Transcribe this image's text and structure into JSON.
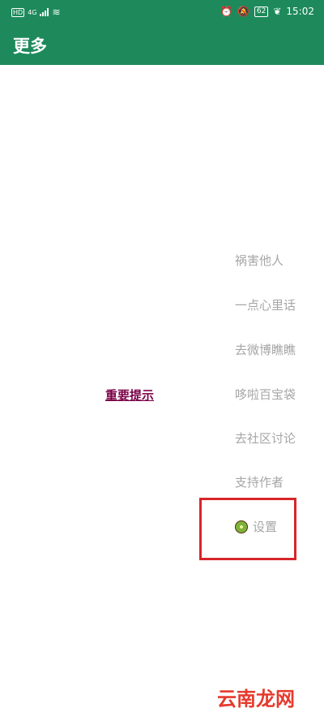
{
  "status_bar": {
    "hd_badge": "HD",
    "network": "4G",
    "battery": "62",
    "time": "15:02"
  },
  "app_bar": {
    "title": "更多"
  },
  "notice_link": "重要提示",
  "menu": [
    {
      "label": "祸害他人"
    },
    {
      "label": "一点心里话"
    },
    {
      "label": "去微博瞧瞧"
    },
    {
      "label": "哆啦百宝袋"
    },
    {
      "label": "去社区讨论"
    },
    {
      "label": "支持作者"
    },
    {
      "label": "设置",
      "icon": "kiwi-icon"
    }
  ],
  "watermark": "云南龙网",
  "colors": {
    "primary": "#1e8a5c",
    "highlight": "#d7262a",
    "notice": "#7a0047"
  }
}
